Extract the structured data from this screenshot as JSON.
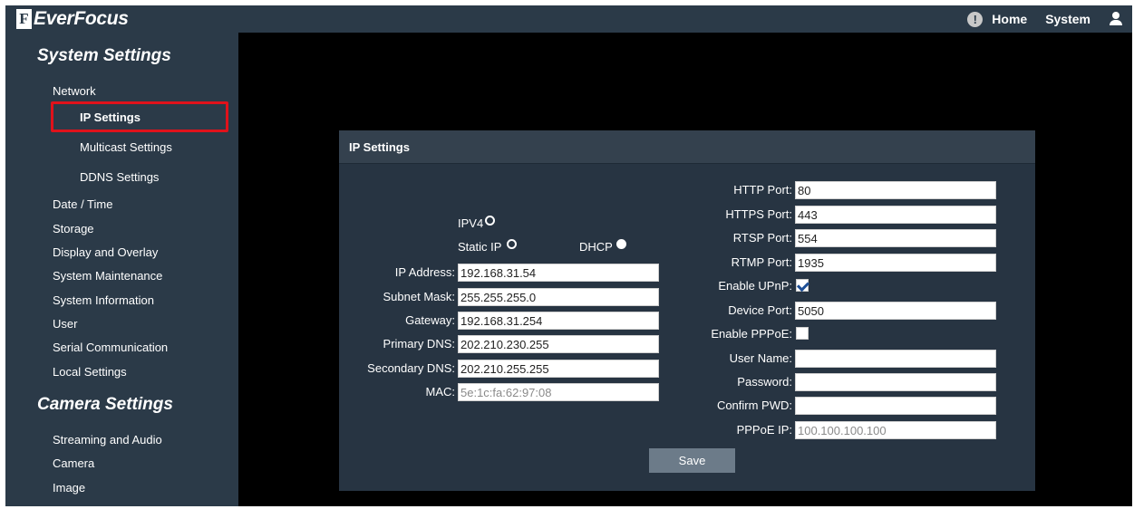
{
  "header": {
    "brand": "EverFocus",
    "brand_mark": "F",
    "alert_glyph": "!",
    "home_label": "Home",
    "system_label": "System"
  },
  "sidebar": {
    "system_title": "System Settings",
    "network": "Network",
    "ip_settings": "IP Settings",
    "multicast": "Multicast Settings",
    "ddns": "DDNS Settings",
    "date_time": "Date / Time",
    "storage": "Storage",
    "display_overlay": "Display and Overlay",
    "maintenance": "System Maintenance",
    "information": "System Information",
    "user": "User",
    "serial": "Serial Communication",
    "local": "Local Settings",
    "camera_title": "Camera Settings",
    "streaming": "Streaming and Audio",
    "camera": "Camera",
    "image": "Image",
    "active_item": "IP Settings",
    "highlight_color": "#e0121b"
  },
  "panel": {
    "title": "IP Settings",
    "left": {
      "ipv4_label": "IPV4",
      "static_label": "Static IP",
      "dhcp_label": "DHCP",
      "ip_label": "IP Address:",
      "ip_value": "192.168.31.54",
      "subnet_label": "Subnet Mask:",
      "subnet_value": "255.255.255.0",
      "gateway_label": "Gateway:",
      "gateway_value": "192.168.31.254",
      "pdns_label": "Primary DNS:",
      "pdns_value": "202.210.230.255",
      "sdns_label": "Secondary DNS:",
      "sdns_value": "202.210.255.255",
      "mac_label": "MAC:",
      "mac_value": "5e:1c:fa:62:97:08"
    },
    "right": {
      "http_label": "HTTP Port:",
      "http_value": "80",
      "https_label": "HTTPS Port:",
      "https_value": "443",
      "rtsp_label": "RTSP Port:",
      "rtsp_value": "554",
      "rtmp_label": "RTMP Port:",
      "rtmp_value": "1935",
      "upnp_label": "Enable UPnP:",
      "upnp_checked": true,
      "device_label": "Device Port:",
      "device_value": "5050",
      "pppoe_label": "Enable PPPoE:",
      "pppoe_checked": false,
      "username_label": "User Name:",
      "username_value": "",
      "password_label": "Password:",
      "password_value": "",
      "confirm_label": "Confirm PWD:",
      "confirm_value": "",
      "pppoe_ip_label": "PPPoE IP:",
      "pppoe_ip_value": "100.100.100.100"
    },
    "save_label": "Save"
  },
  "colors": {
    "sidebar_bg": "#2b3a48",
    "panel_bg": "#273442",
    "content_bg": "#000000",
    "button_bg": "#6c7b89"
  }
}
